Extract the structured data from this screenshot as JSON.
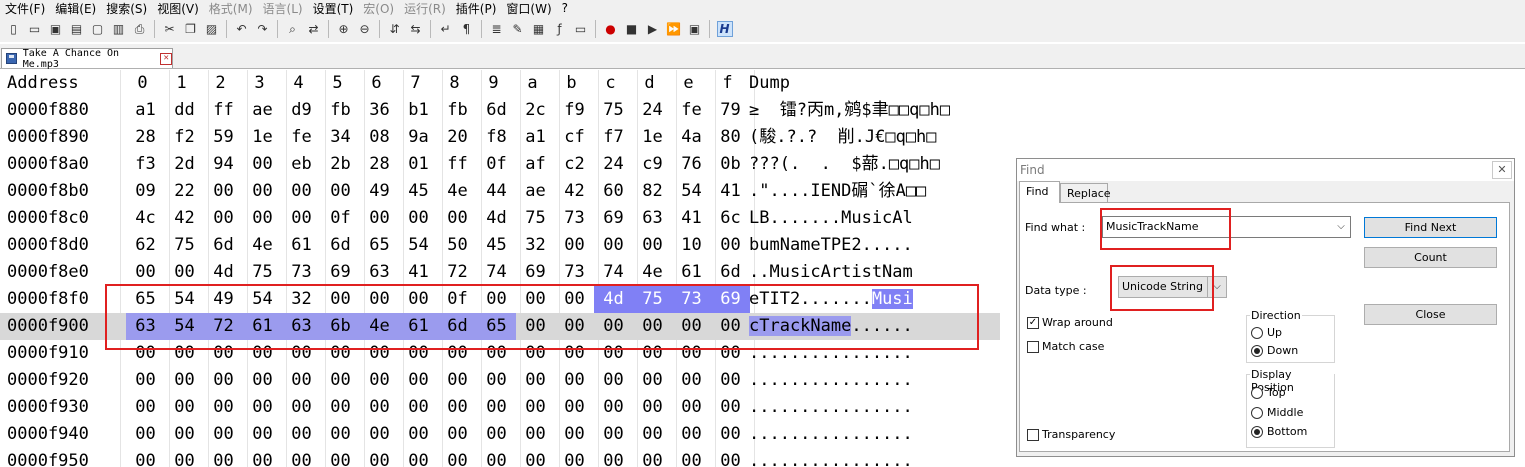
{
  "menu": [
    "文件(F)",
    "编辑(E)",
    "搜索(S)",
    "视图(V)",
    "格式(M)",
    "语言(L)",
    "设置(T)",
    "宏(O)",
    "运行(R)",
    "插件(P)",
    "窗口(W)",
    "?"
  ],
  "menu_disabled": [
    false,
    false,
    false,
    false,
    true,
    true,
    false,
    true,
    true,
    false,
    false,
    false
  ],
  "toolbar_icons": [
    "new-file-icon",
    "open-file-icon",
    "save-icon",
    "save-all-icon",
    "close-icon",
    "close-all-icon",
    "print-icon",
    "|",
    "cut-icon",
    "copy-icon",
    "paste-icon",
    "|",
    "undo-icon",
    "redo-icon",
    "|",
    "find-icon",
    "replace-icon",
    "|",
    "zoom-in-icon",
    "zoom-out-icon",
    "|",
    "sync-v-icon",
    "sync-h-icon",
    "|",
    "word-wrap-icon",
    "show-all-chars-icon",
    "|",
    "indent-guide-icon",
    "udl-icon",
    "doc-map-icon",
    "function-list-icon",
    "folder-workspace-icon",
    "|",
    "record-macro-icon",
    "stop-macro-icon",
    "play-macro-icon",
    "run-macro-multi-icon",
    "save-macro-icon",
    "|",
    "hex-editor-icon"
  ],
  "hex_button_label": "H",
  "tab": {
    "title": "Take A Chance On Me.mp3"
  },
  "hex": {
    "header": {
      "address": "Address",
      "columns": [
        "0",
        "1",
        "2",
        "3",
        "4",
        "5",
        "6",
        "7",
        "8",
        "9",
        "a",
        "b",
        "c",
        "d",
        "e",
        "f"
      ],
      "dump": "Dump"
    },
    "rows": [
      {
        "addr": "0000f880",
        "bytes": [
          "a1",
          "dd",
          "ff",
          "ae",
          "d9",
          "fb",
          "36",
          "b1",
          "fb",
          "6d",
          "2c",
          "f9",
          "75",
          "24",
          "fe",
          "79"
        ],
        "dump": "≥  镭?丙m,鹓$聿□□q□h□"
      },
      {
        "addr": "0000f890",
        "bytes": [
          "28",
          "f2",
          "59",
          "1e",
          "fe",
          "34",
          "08",
          "9a",
          "20",
          "f8",
          "a1",
          "cf",
          "f7",
          "1e",
          "4a",
          "80"
        ],
        "dump": "(駿.?.?  削.J€□q□h□"
      },
      {
        "addr": "0000f8a0",
        "bytes": [
          "f3",
          "2d",
          "94",
          "00",
          "eb",
          "2b",
          "28",
          "01",
          "ff",
          "0f",
          "af",
          "c2",
          "24",
          "c9",
          "76",
          "0b"
        ],
        "dump": "???(.  .  $蔀.□q□h□"
      },
      {
        "addr": "0000f8b0",
        "bytes": [
          "09",
          "22",
          "00",
          "00",
          "00",
          "00",
          "49",
          "45",
          "4e",
          "44",
          "ae",
          "42",
          "60",
          "82",
          "54",
          "41"
        ],
        "dump": ".\"....IEND碿`徐A□□"
      },
      {
        "addr": "0000f8c0",
        "bytes": [
          "4c",
          "42",
          "00",
          "00",
          "00",
          "0f",
          "00",
          "00",
          "00",
          "4d",
          "75",
          "73",
          "69",
          "63",
          "41",
          "6c"
        ],
        "dump": "LB.......MusicAl"
      },
      {
        "addr": "0000f8d0",
        "bytes": [
          "62",
          "75",
          "6d",
          "4e",
          "61",
          "6d",
          "65",
          "54",
          "50",
          "45",
          "32",
          "00",
          "00",
          "00",
          "10",
          "00"
        ],
        "dump": "bumNameTPE2....."
      },
      {
        "addr": "0000f8e0",
        "bytes": [
          "00",
          "00",
          "4d",
          "75",
          "73",
          "69",
          "63",
          "41",
          "72",
          "74",
          "69",
          "73",
          "74",
          "4e",
          "61",
          "6d"
        ],
        "dump": "..MusicArtistNam"
      },
      {
        "addr": "0000f8f0",
        "bytes": [
          "65",
          "54",
          "49",
          "54",
          "32",
          "00",
          "00",
          "00",
          "0f",
          "00",
          "00",
          "00",
          "4d",
          "75",
          "73",
          "69"
        ],
        "dump_plain": "eTIT2.......",
        "dump_hl": "Musi"
      },
      {
        "addr": "0000f900",
        "bytes": [
          "63",
          "54",
          "72",
          "61",
          "63",
          "6b",
          "4e",
          "61",
          "6d",
          "65",
          "00",
          "00",
          "00",
          "00",
          "00",
          "00"
        ],
        "dump_hl": "cTrackName",
        "dump_plain": "......"
      },
      {
        "addr": "0000f910",
        "bytes": [
          "00",
          "00",
          "00",
          "00",
          "00",
          "00",
          "00",
          "00",
          "00",
          "00",
          "00",
          "00",
          "00",
          "00",
          "00",
          "00"
        ],
        "dump": "................"
      },
      {
        "addr": "0000f920",
        "bytes": [
          "00",
          "00",
          "00",
          "00",
          "00",
          "00",
          "00",
          "00",
          "00",
          "00",
          "00",
          "00",
          "00",
          "00",
          "00",
          "00"
        ],
        "dump": "................"
      },
      {
        "addr": "0000f930",
        "bytes": [
          "00",
          "00",
          "00",
          "00",
          "00",
          "00",
          "00",
          "00",
          "00",
          "00",
          "00",
          "00",
          "00",
          "00",
          "00",
          "00"
        ],
        "dump": "................"
      },
      {
        "addr": "0000f940",
        "bytes": [
          "00",
          "00",
          "00",
          "00",
          "00",
          "00",
          "00",
          "00",
          "00",
          "00",
          "00",
          "00",
          "00",
          "00",
          "00",
          "00"
        ],
        "dump": "................"
      },
      {
        "addr": "0000f950",
        "bytes": [
          "00",
          "00",
          "00",
          "00",
          "00",
          "00",
          "00",
          "00",
          "00",
          "00",
          "00",
          "00",
          "00",
          "00",
          "00",
          "00"
        ],
        "dump": "................"
      }
    ]
  },
  "find_dialog": {
    "title": "Find",
    "close_glyph": "✕",
    "tabs": [
      "Find",
      "Replace"
    ],
    "find_what_label": "Find what :",
    "find_what_value": "MusicTrackName",
    "data_type_label": "Data type :",
    "data_type_value": "Unicode String",
    "wrap_around": "Wrap around",
    "match_case": "Match case",
    "transparency": "Transparency",
    "direction": {
      "title": "Direction",
      "up": "Up",
      "down": "Down"
    },
    "display_position": {
      "title": "Display Position",
      "top": "Top",
      "middle": "Middle",
      "bottom": "Bottom"
    },
    "buttons": {
      "find_next": "Find Next",
      "count": "Count",
      "close": "Close"
    }
  }
}
